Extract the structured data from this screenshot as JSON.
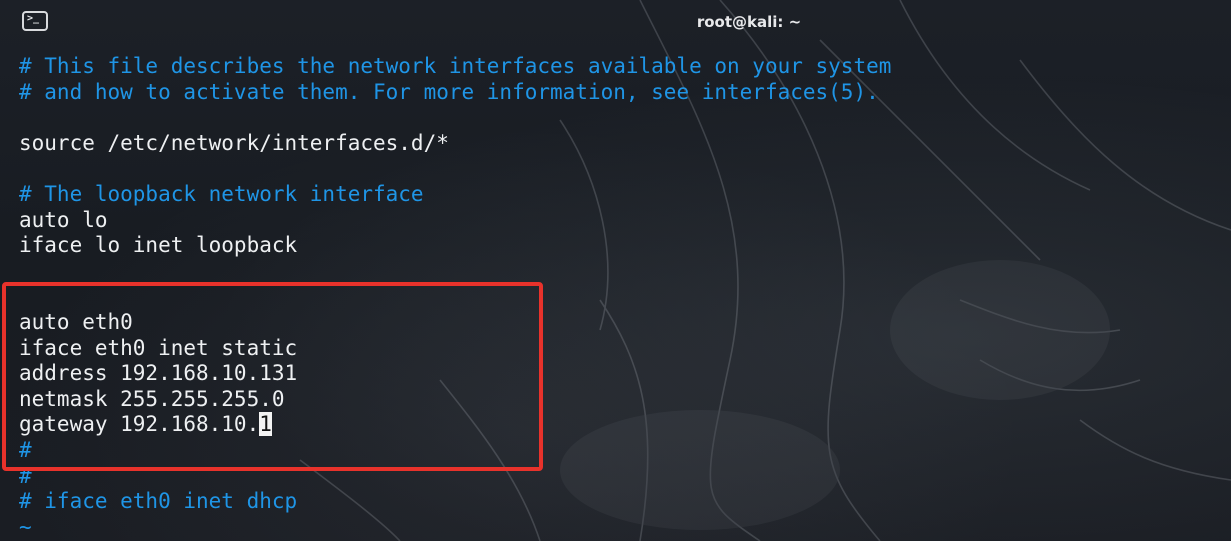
{
  "window": {
    "title": "root@kali: ~",
    "icon": "terminal-icon"
  },
  "editor": {
    "lines": [
      {
        "text": "# This file describes the network interfaces available on your system",
        "type": "comment"
      },
      {
        "text": "# and how to activate them. For more information, see interfaces(5).",
        "type": "comment"
      },
      {
        "text": "",
        "type": "blank"
      },
      {
        "text": "source /etc/network/interfaces.d/*",
        "type": "code"
      },
      {
        "text": "",
        "type": "blank"
      },
      {
        "text": "# The loopback network interface",
        "type": "comment"
      },
      {
        "text": "auto lo",
        "type": "code"
      },
      {
        "text": "iface lo inet loopback",
        "type": "code"
      },
      {
        "text": "",
        "type": "blank"
      },
      {
        "text": "",
        "type": "blank"
      },
      {
        "text": "auto eth0",
        "type": "code"
      },
      {
        "text": "iface eth0 inet static",
        "type": "code"
      },
      {
        "text": "address 192.168.10.131",
        "type": "code"
      },
      {
        "text": "netmask 255.255.255.0",
        "type": "code"
      },
      {
        "text": "gateway 192.168.10.1",
        "type": "code"
      },
      {
        "text": "#",
        "type": "comment"
      },
      {
        "text": "#",
        "type": "comment"
      },
      {
        "text": "# iface eth0 inet dhcp",
        "type": "comment"
      },
      {
        "text": "~",
        "type": "tilde"
      }
    ],
    "cursor": {
      "line": 14,
      "column": 19
    }
  },
  "annotation": {
    "box_color": "#e8322b"
  },
  "colors": {
    "comment": "#1f95e6",
    "code": "#eef0f2",
    "background": "#1a1d23"
  }
}
